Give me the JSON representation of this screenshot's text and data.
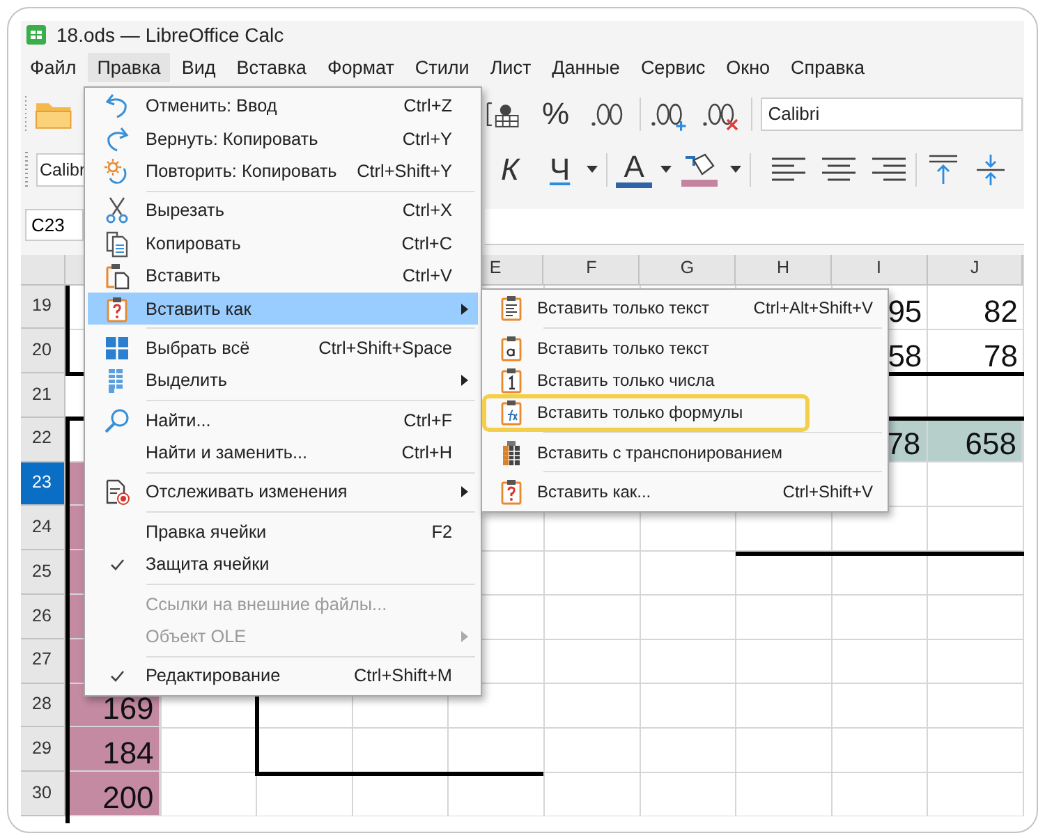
{
  "window": {
    "title": "18.ods — LibreOffice Calc"
  },
  "menu_bar": [
    {
      "label": "Файл",
      "selected": false
    },
    {
      "label": "Правка",
      "selected": true
    },
    {
      "label": "Вид",
      "selected": false
    },
    {
      "label": "Вставка",
      "selected": false
    },
    {
      "label": "Формат",
      "selected": false
    },
    {
      "label": "Стили",
      "selected": false
    },
    {
      "label": "Лист",
      "selected": false
    },
    {
      "label": "Данные",
      "selected": false
    },
    {
      "label": "Сервис",
      "selected": false
    },
    {
      "label": "Окно",
      "selected": false
    },
    {
      "label": "Справка",
      "selected": false
    }
  ],
  "toolbar_top": {
    "percent_button": "%",
    "font_name": "Calibri"
  },
  "toolbar_bottom": {
    "font_field": "Calibr",
    "italic_button": "К",
    "underline_button": "Ч",
    "font_color_button": "A"
  },
  "formula_bar": {
    "name_box": "C23"
  },
  "sheet": {
    "columns": [
      {
        "label": "E"
      },
      {
        "label": "F"
      },
      {
        "label": "G"
      },
      {
        "label": "H"
      },
      {
        "label": "I"
      },
      {
        "label": "J"
      }
    ],
    "rows": [
      {
        "number": "19",
        "selected": false,
        "cells": {
          "I": {
            "text": "95"
          },
          "J": {
            "text": "82"
          }
        }
      },
      {
        "number": "20",
        "selected": false,
        "cells": {
          "I": {
            "text": "58"
          },
          "J": {
            "text": "78"
          }
        }
      },
      {
        "number": "21",
        "selected": false,
        "cells": {}
      },
      {
        "number": "22",
        "selected": false,
        "cells": {
          "I": {
            "text": "78",
            "color": "#b7cfcb"
          },
          "J": {
            "text": "658",
            "color": "#b7cfcb"
          }
        }
      },
      {
        "number": "23",
        "selected": true,
        "cells": {
          "A": {
            "color": "#c48aa2"
          }
        }
      },
      {
        "number": "24",
        "selected": false,
        "cells": {
          "A": {
            "color": "#c48aa2"
          }
        }
      },
      {
        "number": "25",
        "selected": false,
        "cells": {
          "A": {
            "color": "#c48aa2"
          }
        }
      },
      {
        "number": "26",
        "selected": false,
        "cells": {
          "A": {
            "color": "#c48aa2"
          }
        }
      },
      {
        "number": "27",
        "selected": false,
        "cells": {
          "A": {
            "color": "#c48aa2"
          }
        }
      },
      {
        "number": "28",
        "selected": false,
        "cells": {
          "A": {
            "text": "169",
            "color": "#c48aa2"
          }
        }
      },
      {
        "number": "29",
        "selected": false,
        "cells": {
          "A": {
            "text": "184",
            "color": "#c48aa2"
          }
        }
      },
      {
        "number": "30",
        "selected": false,
        "cells": {
          "A": {
            "text": "200",
            "color": "#c48aa2"
          }
        }
      }
    ]
  },
  "edit_menu": {
    "items": [
      {
        "kind": "item",
        "label": "Отменить: Ввод",
        "shortcut": "Ctrl+Z",
        "submenu": false,
        "checked": false,
        "disabled": false,
        "selected": false
      },
      {
        "kind": "item",
        "label": "Вернуть: Копировать",
        "shortcut": "Ctrl+Y",
        "submenu": false,
        "checked": false,
        "disabled": false,
        "selected": false
      },
      {
        "kind": "item",
        "label": "Повторить: Копировать",
        "shortcut": "Ctrl+Shift+Y",
        "submenu": false,
        "checked": false,
        "disabled": false,
        "selected": false
      },
      {
        "kind": "separator"
      },
      {
        "kind": "item",
        "label": "Вырезать",
        "shortcut": "Ctrl+X",
        "submenu": false,
        "checked": false,
        "disabled": false,
        "selected": false
      },
      {
        "kind": "item",
        "label": "Копировать",
        "shortcut": "Ctrl+C",
        "submenu": false,
        "checked": false,
        "disabled": false,
        "selected": false
      },
      {
        "kind": "item",
        "label": "Вставить",
        "shortcut": "Ctrl+V",
        "submenu": false,
        "checked": false,
        "disabled": false,
        "selected": false
      },
      {
        "kind": "item",
        "label": "Вставить как",
        "submenu": true,
        "checked": false,
        "disabled": false,
        "selected": true
      },
      {
        "kind": "separator"
      },
      {
        "kind": "item",
        "label": "Выбрать всё",
        "shortcut": "Ctrl+Shift+Space",
        "submenu": false,
        "checked": false,
        "disabled": false,
        "selected": false
      },
      {
        "kind": "item",
        "label": "Выделить",
        "submenu": true,
        "checked": false,
        "disabled": false,
        "selected": false
      },
      {
        "kind": "separator"
      },
      {
        "kind": "item",
        "label": "Найти...",
        "shortcut": "Ctrl+F",
        "submenu": false,
        "checked": false,
        "disabled": false,
        "selected": false
      },
      {
        "kind": "item",
        "label": "Найти и заменить...",
        "shortcut": "Ctrl+H",
        "submenu": false,
        "checked": false,
        "disabled": false,
        "selected": false
      },
      {
        "kind": "separator"
      },
      {
        "kind": "item",
        "label": "Отслеживать изменения",
        "submenu": true,
        "checked": false,
        "disabled": false,
        "selected": false
      },
      {
        "kind": "separator"
      },
      {
        "kind": "item",
        "label": "Правка ячейки",
        "shortcut": "F2",
        "submenu": false,
        "checked": false,
        "disabled": false,
        "selected": false
      },
      {
        "kind": "item",
        "label": "Защита ячейки",
        "submenu": false,
        "checked": true,
        "disabled": false,
        "selected": false
      },
      {
        "kind": "separator"
      },
      {
        "kind": "item",
        "label": "Ссылки на внешние файлы...",
        "submenu": false,
        "checked": false,
        "disabled": true,
        "selected": false
      },
      {
        "kind": "item",
        "label": "Объект OLE",
        "submenu": true,
        "checked": false,
        "disabled": true,
        "selected": false
      },
      {
        "kind": "separator"
      },
      {
        "kind": "item",
        "label": "Редактирование",
        "shortcut": "Ctrl+Shift+M",
        "submenu": false,
        "checked": true,
        "disabled": false,
        "selected": false
      }
    ]
  },
  "paste_special_menu": {
    "items": [
      {
        "kind": "item",
        "label": "Вставить только текст",
        "shortcut": "Ctrl+Alt+Shift+V",
        "submenu": false,
        "checked": false,
        "disabled": false,
        "selected": false
      },
      {
        "kind": "separator"
      },
      {
        "kind": "item",
        "label": "Вставить только текст",
        "submenu": false,
        "checked": false,
        "disabled": false,
        "selected": false
      },
      {
        "kind": "item",
        "label": "Вставить только числа",
        "submenu": false,
        "checked": false,
        "disabled": false,
        "selected": false
      },
      {
        "kind": "item",
        "label": "Вставить только формулы",
        "submenu": false,
        "checked": false,
        "disabled": false,
        "selected": true
      },
      {
        "kind": "separator"
      },
      {
        "kind": "item",
        "label": "Вставить с транспонированием",
        "submenu": false,
        "checked": false,
        "disabled": false,
        "selected": false
      },
      {
        "kind": "separator"
      },
      {
        "kind": "item",
        "label": "Вставить как...",
        "shortcut": "Ctrl+Shift+V",
        "submenu": false,
        "checked": false,
        "disabled": false,
        "selected": false
      }
    ]
  }
}
